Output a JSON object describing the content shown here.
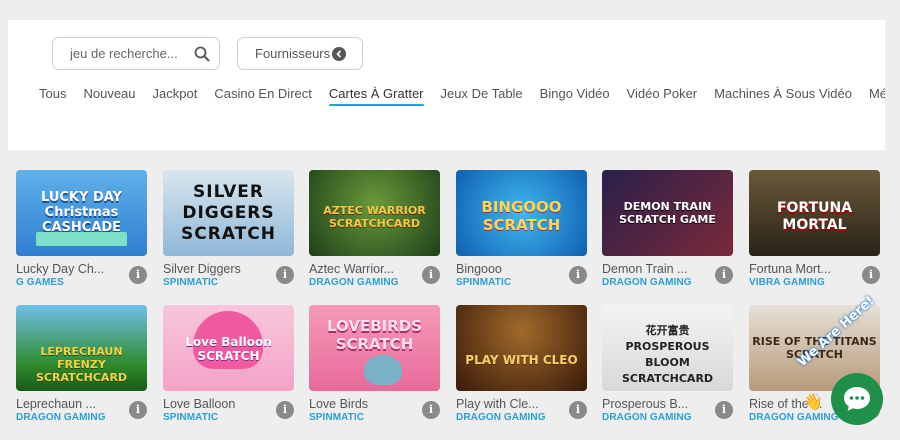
{
  "search": {
    "placeholder": "jeu de recherche..."
  },
  "providers_button": {
    "label": "Fournisseurs"
  },
  "tabs": [
    {
      "label": "Tous"
    },
    {
      "label": "Nouveau"
    },
    {
      "label": "Jackpot"
    },
    {
      "label": "Casino En Direct"
    },
    {
      "label": "Cartes À Gratter",
      "active": true
    },
    {
      "label": "Jeux De Table"
    },
    {
      "label": "Bingo Vidéo"
    },
    {
      "label": "Vidéo Poker"
    },
    {
      "label": "Machines À Sous Vidéo"
    },
    {
      "label": "Mégalo"
    }
  ],
  "games": [
    {
      "title": "Lucky Day Ch...",
      "provider": "G GAMES",
      "thumb_text": "LUCKY DAY Christmas CASHCADE"
    },
    {
      "title": "Silver Diggers",
      "provider": "SPINMATIC",
      "thumb_text": "SILVER DIGGERS SCRATCH"
    },
    {
      "title": "Aztec Warrior...",
      "provider": "DRAGON GAMING",
      "thumb_text": "AZTEC WARRIOR SCRATCHCARD"
    },
    {
      "title": "Bingooo",
      "provider": "SPINMATIC",
      "thumb_text": "BINGOOO SCRATCH"
    },
    {
      "title": "Demon Train ...",
      "provider": "DRAGON GAMING",
      "thumb_text": "DEMON TRAIN SCRATCH GAME"
    },
    {
      "title": "Fortuna Mort...",
      "provider": "VIBRA GAMING",
      "thumb_text": "FORTUNA MORTAL"
    },
    {
      "title": "Leprechaun ...",
      "provider": "DRAGON GAMING",
      "thumb_text": "LEPRECHAUN FRENZY SCRATCHCARD"
    },
    {
      "title": "Love Balloon",
      "provider": "SPINMATIC",
      "thumb_text": "Love Balloon SCRATCH"
    },
    {
      "title": "Love Birds",
      "provider": "SPINMATIC",
      "thumb_text": "LOVEBIRDS SCRATCH"
    },
    {
      "title": "Play with Cle...",
      "provider": "DRAGON GAMING",
      "thumb_text": "PLAY WITH CLEO"
    },
    {
      "title": "Prosperous B...",
      "provider": "DRAGON GAMING",
      "thumb_text": "花开富贵 PROSPEROUS BLOOM SCRATCHCARD"
    },
    {
      "title": "Rise of the ...",
      "provider": "DRAGON GAMING",
      "thumb_text": "RISE OF THE TITANS SCRATCH"
    }
  ],
  "info_glyph": "i",
  "chat": {
    "label": "We Are Here!",
    "icon": "chat-icon"
  },
  "colors": {
    "accent": "#2a9fd6",
    "chat": "#1f8f4a"
  }
}
